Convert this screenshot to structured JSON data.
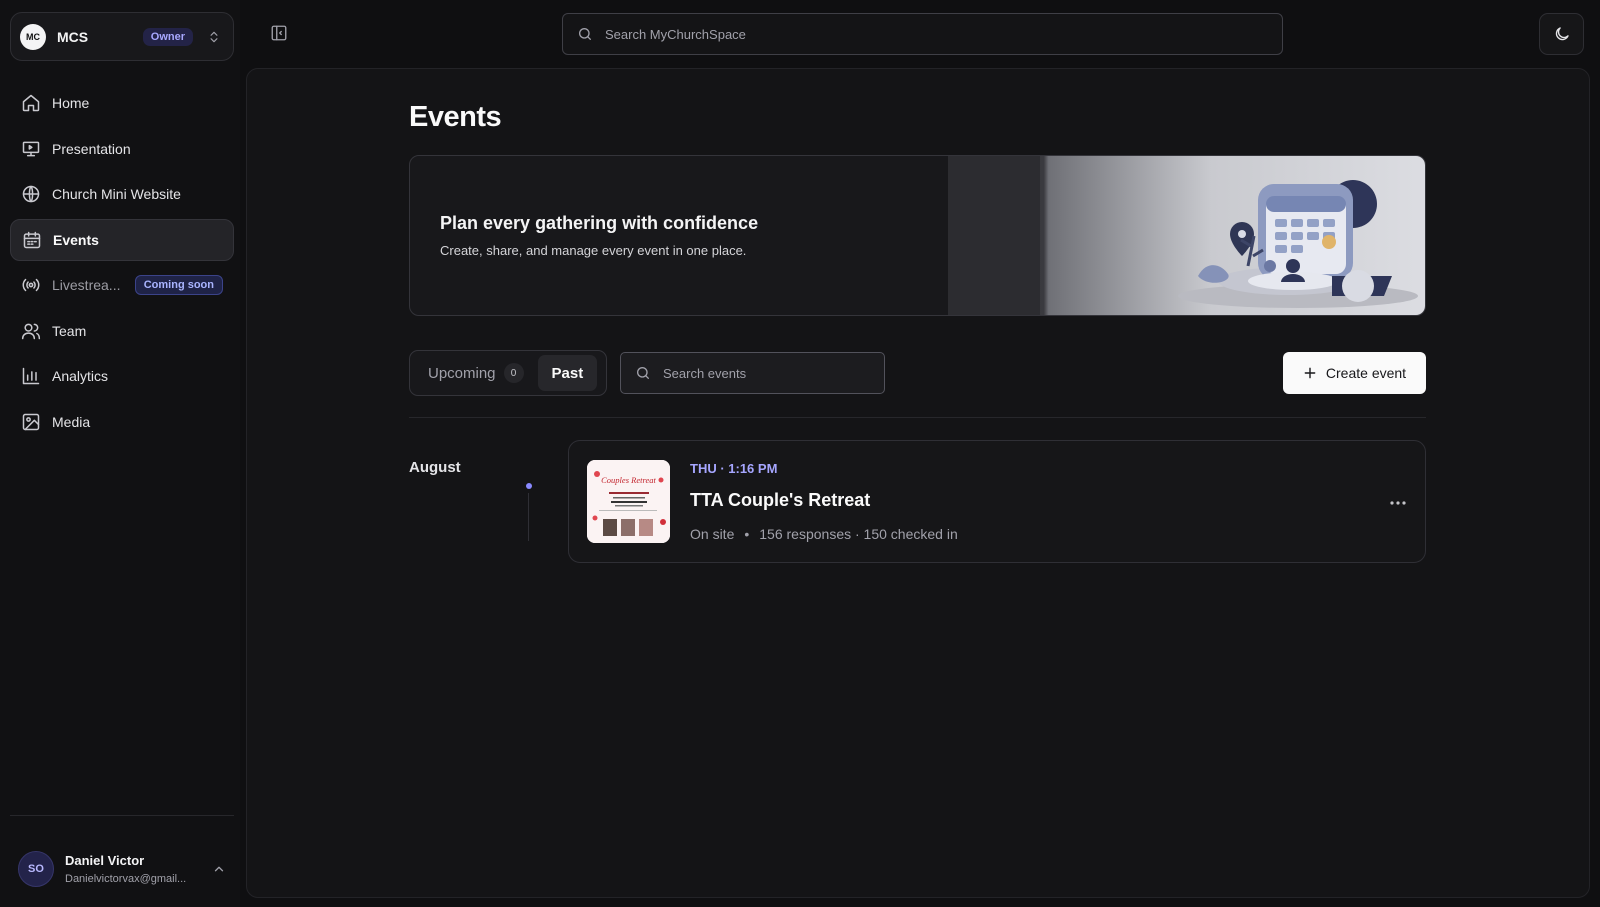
{
  "workspace": {
    "initials": "MC",
    "name": "MCS",
    "role_badge": "Owner"
  },
  "sidebar": {
    "items": [
      {
        "label": "Home",
        "icon": "home-icon"
      },
      {
        "label": "Presentation",
        "icon": "presentation-icon"
      },
      {
        "label": "Church Mini Website",
        "icon": "globe-icon"
      },
      {
        "label": "Events",
        "icon": "calendar-icon",
        "active": true
      },
      {
        "label": "Livestrea...",
        "icon": "broadcast-icon",
        "badge": "Coming soon"
      },
      {
        "label": "Team",
        "icon": "users-icon"
      },
      {
        "label": "Analytics",
        "icon": "bar-chart-icon"
      },
      {
        "label": "Media",
        "icon": "image-icon"
      }
    ]
  },
  "user": {
    "initials": "SO",
    "name": "Daniel Victor",
    "email": "Danielvictorvax@gmail..."
  },
  "search": {
    "placeholder": "Search MyChurchSpace"
  },
  "page": {
    "title": "Events"
  },
  "hero": {
    "title": "Plan every gathering with confidence",
    "subtitle": "Create, share, and manage every event in one place."
  },
  "tabs": [
    {
      "label": "Upcoming",
      "count": "0",
      "active": false
    },
    {
      "label": "Past",
      "active": true
    }
  ],
  "event_search": {
    "placeholder": "Search events"
  },
  "actions": {
    "create_event": "Create event"
  },
  "events": {
    "month": "August",
    "items": [
      {
        "time": "THU · 1:16 PM",
        "title": "TTA Couple's Retreat",
        "location": "On site",
        "stats": "156 responses · 150 checked in",
        "thumb_text": "Couples Retreat"
      }
    ]
  },
  "colors": {
    "accent": "#a6a6ff",
    "background": "#0f0f11",
    "surface": "#18181b",
    "primary_button": "#fafafa"
  }
}
